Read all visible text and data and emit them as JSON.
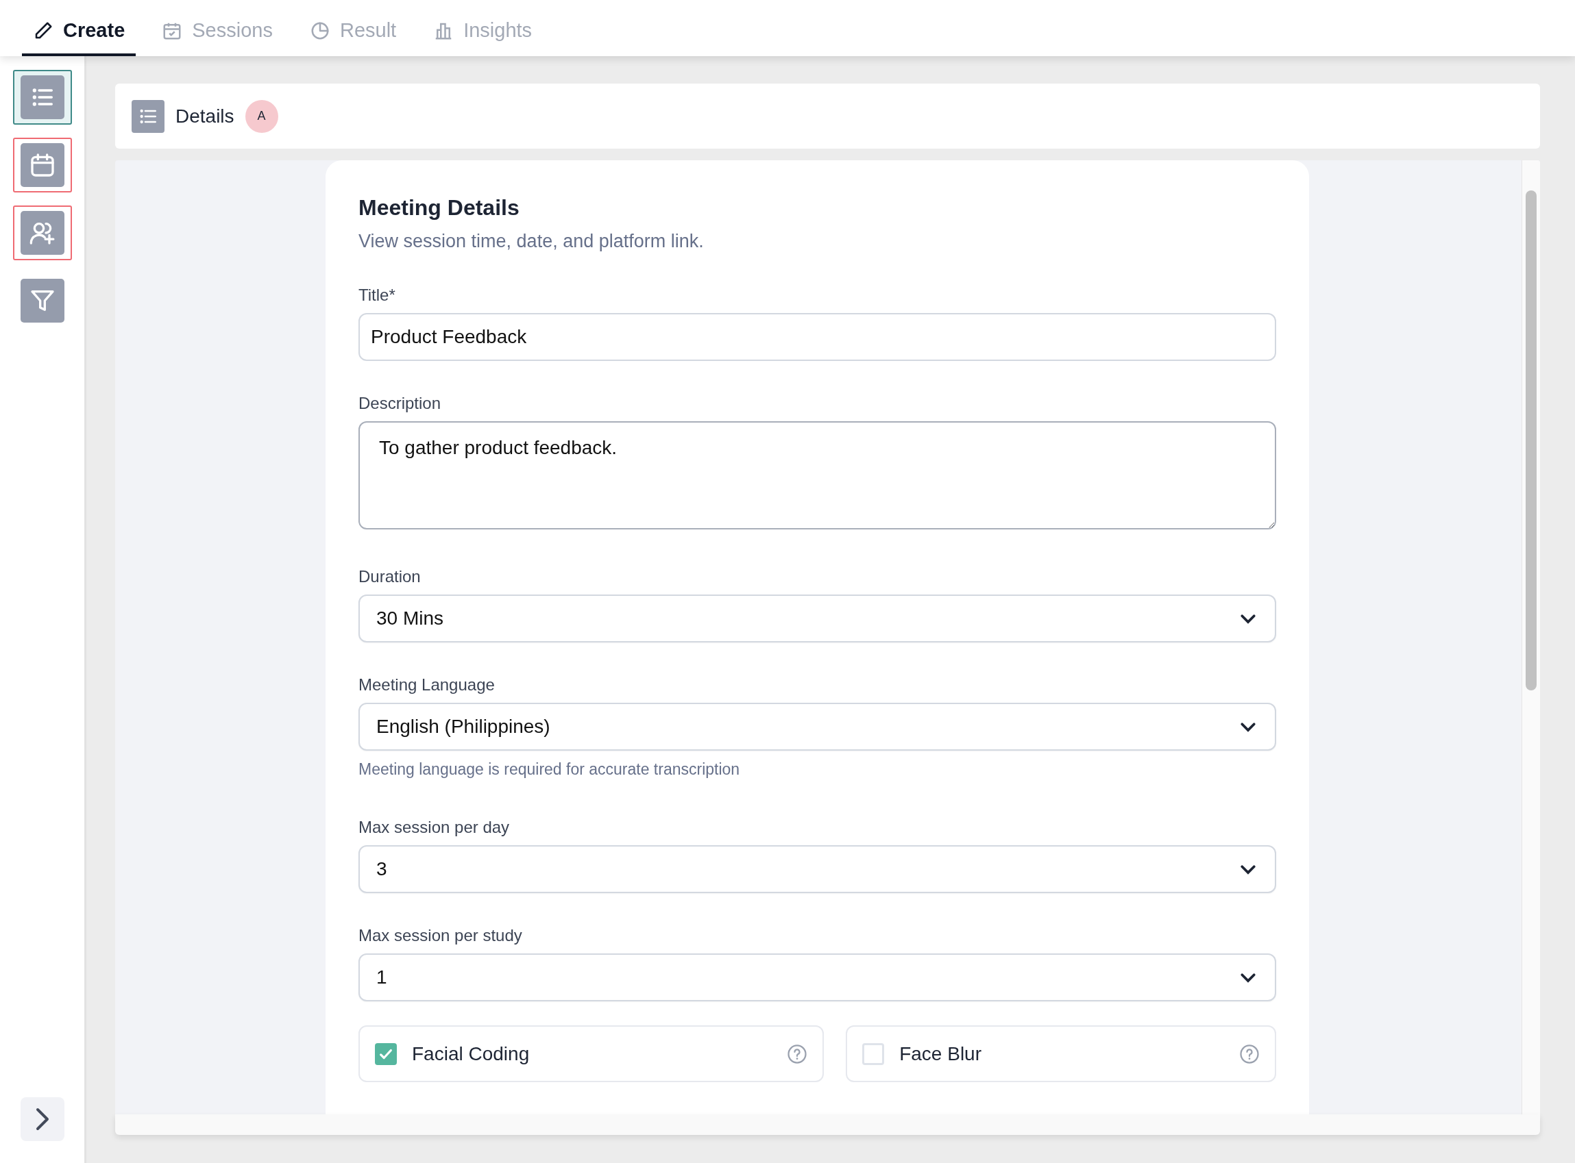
{
  "tabs": [
    {
      "label": "Create",
      "selected": true
    },
    {
      "label": "Sessions",
      "selected": false
    },
    {
      "label": "Result",
      "selected": false
    },
    {
      "label": "Insights",
      "selected": false
    }
  ],
  "sidebar": {
    "items": [
      {
        "selected": true,
        "flagged": false
      },
      {
        "selected": false,
        "flagged": true
      },
      {
        "selected": false,
        "flagged": true
      },
      {
        "selected": false,
        "flagged": false
      }
    ]
  },
  "header": {
    "title": "Details",
    "badge": "A"
  },
  "form": {
    "title": "Meeting Details",
    "subtitle": "View session time, date, and platform link.",
    "fields": [
      {
        "kind": "text",
        "label": "Title*",
        "value": "Product Feedback"
      },
      {
        "kind": "textarea",
        "label": "Description",
        "value": "To gather product feedback."
      },
      {
        "kind": "select",
        "label": "Duration",
        "value": "30 Mins"
      },
      {
        "kind": "select",
        "label": "Meeting Language",
        "value": "English (Philippines)",
        "help": "Meeting language is required for accurate transcription"
      },
      {
        "kind": "select",
        "label": "Max session per day",
        "value": "3"
      },
      {
        "kind": "select",
        "label": "Max session per study",
        "value": "1"
      }
    ],
    "options": [
      {
        "label": "Facial Coding",
        "checked": true
      },
      {
        "label": "Face Blur",
        "checked": false
      }
    ]
  }
}
